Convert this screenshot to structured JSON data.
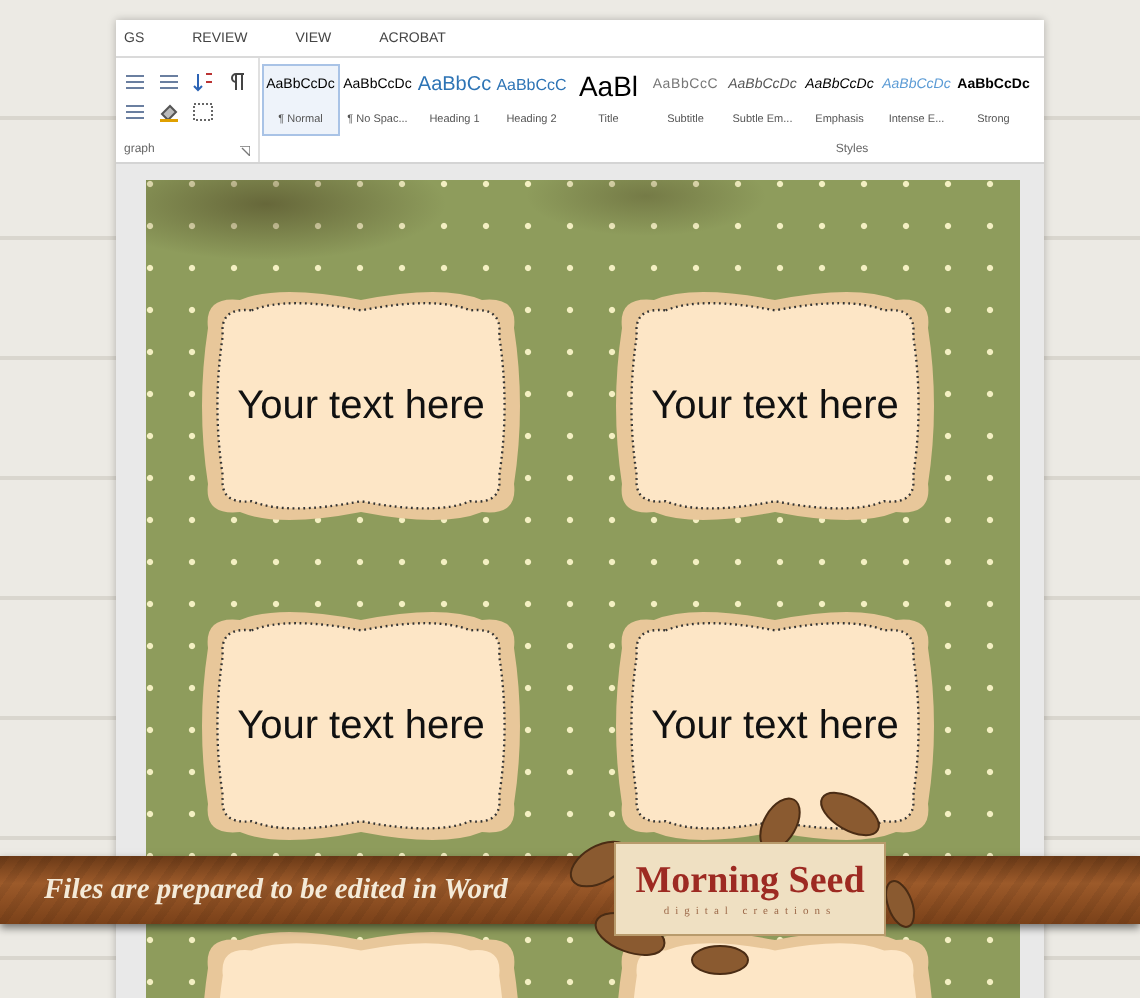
{
  "ribbon": {
    "tabs": [
      {
        "label": "GS",
        "selected": false
      },
      {
        "label": "REVIEW",
        "selected": false
      },
      {
        "label": "VIEW",
        "selected": false
      },
      {
        "label": "ACROBAT",
        "selected": false
      }
    ],
    "paragraph_group": {
      "label": "graph"
    },
    "styles_group": {
      "label": "Styles",
      "styles": [
        {
          "preview": "AaBbCcDc",
          "name": "¶ Normal",
          "kind": "normal",
          "selected": true
        },
        {
          "preview": "AaBbCcDc",
          "name": "¶ No Spac...",
          "kind": "normal",
          "selected": false
        },
        {
          "preview": "AaBbCc",
          "name": "Heading 1",
          "kind": "heading1",
          "selected": false
        },
        {
          "preview": "AaBbCcC",
          "name": "Heading 2",
          "kind": "heading2",
          "selected": false
        },
        {
          "preview": "AaBl",
          "name": "Title",
          "kind": "title",
          "selected": false
        },
        {
          "preview": "AaBbCcC",
          "name": "Subtitle",
          "kind": "subtitle",
          "selected": false
        },
        {
          "preview": "AaBbCcDc",
          "name": "Subtle Em...",
          "kind": "subtle",
          "selected": false
        },
        {
          "preview": "AaBbCcDc",
          "name": "Emphasis",
          "kind": "emphasis",
          "selected": false
        },
        {
          "preview": "AaBbCcDc",
          "name": "Intense E...",
          "kind": "intense",
          "selected": false
        },
        {
          "preview": "AaBbCcDc",
          "name": "Strong",
          "kind": "strong",
          "selected": false
        }
      ]
    }
  },
  "document": {
    "labels": [
      {
        "text": "Your text here"
      },
      {
        "text": "Your text here"
      },
      {
        "text": "Your text here"
      },
      {
        "text": "Your text here"
      }
    ]
  },
  "banner": {
    "text": "Files are prepared to be edited in Word",
    "logo_title": "Morning Seed",
    "logo_subtitle": "digital creations"
  }
}
